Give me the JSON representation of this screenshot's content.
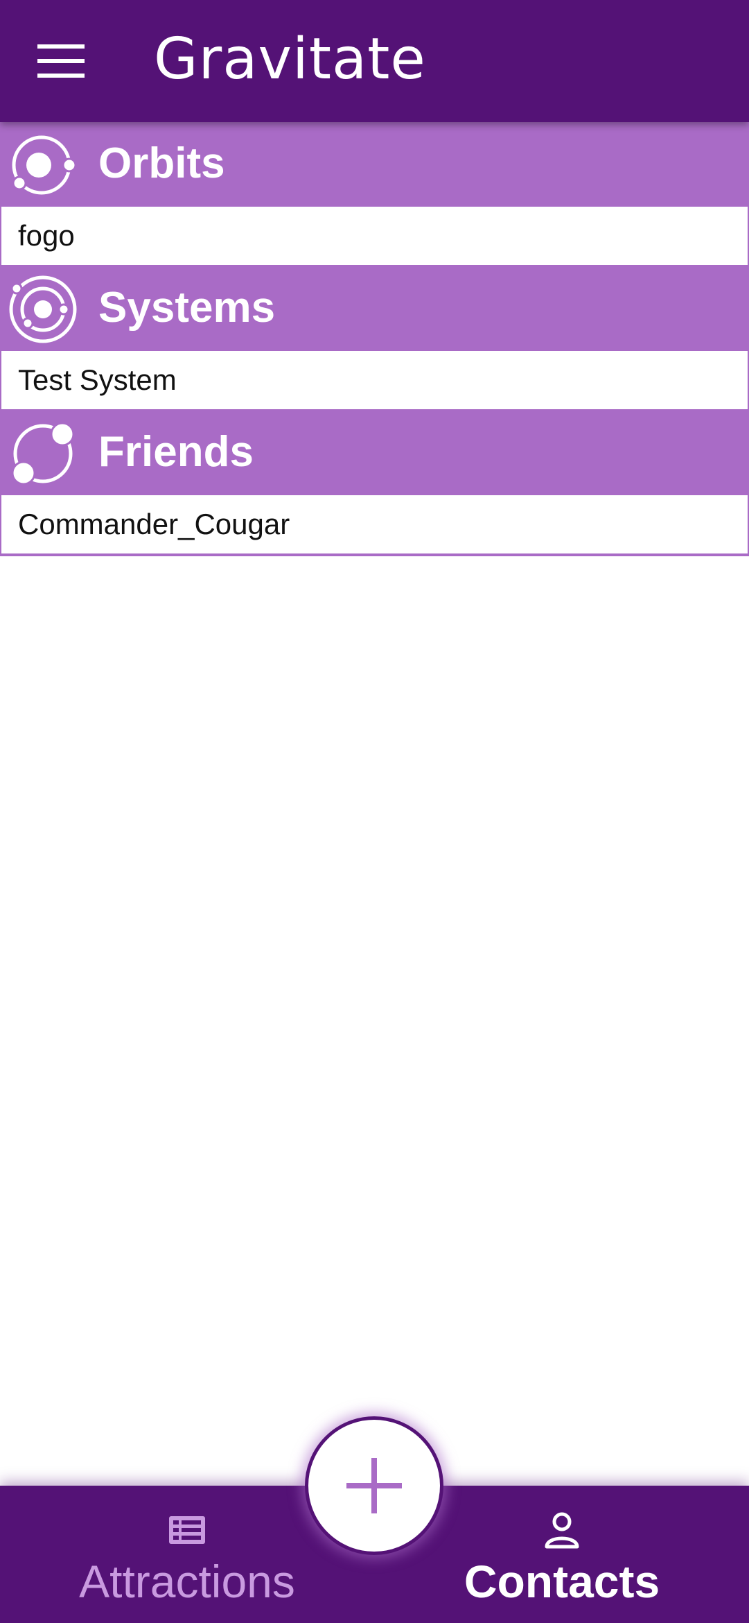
{
  "app": {
    "title": "Gravitate"
  },
  "sections": [
    {
      "title": "Orbits",
      "icon": "orbit-icon",
      "items": [
        "fogo"
      ]
    },
    {
      "title": "Systems",
      "icon": "system-icon",
      "items": [
        "Test System"
      ]
    },
    {
      "title": "Friends",
      "icon": "friends-icon",
      "items": [
        "Commander_Cougar"
      ]
    }
  ],
  "bottom_nav": {
    "attractions_label": "Attractions",
    "contacts_label": "Contacts",
    "active": "Contacts"
  },
  "fab": {
    "icon": "plus-icon"
  },
  "colors": {
    "primary_dark": "#541276",
    "primary_light": "#a96bc6",
    "inactive_nav": "#c99ae0"
  }
}
